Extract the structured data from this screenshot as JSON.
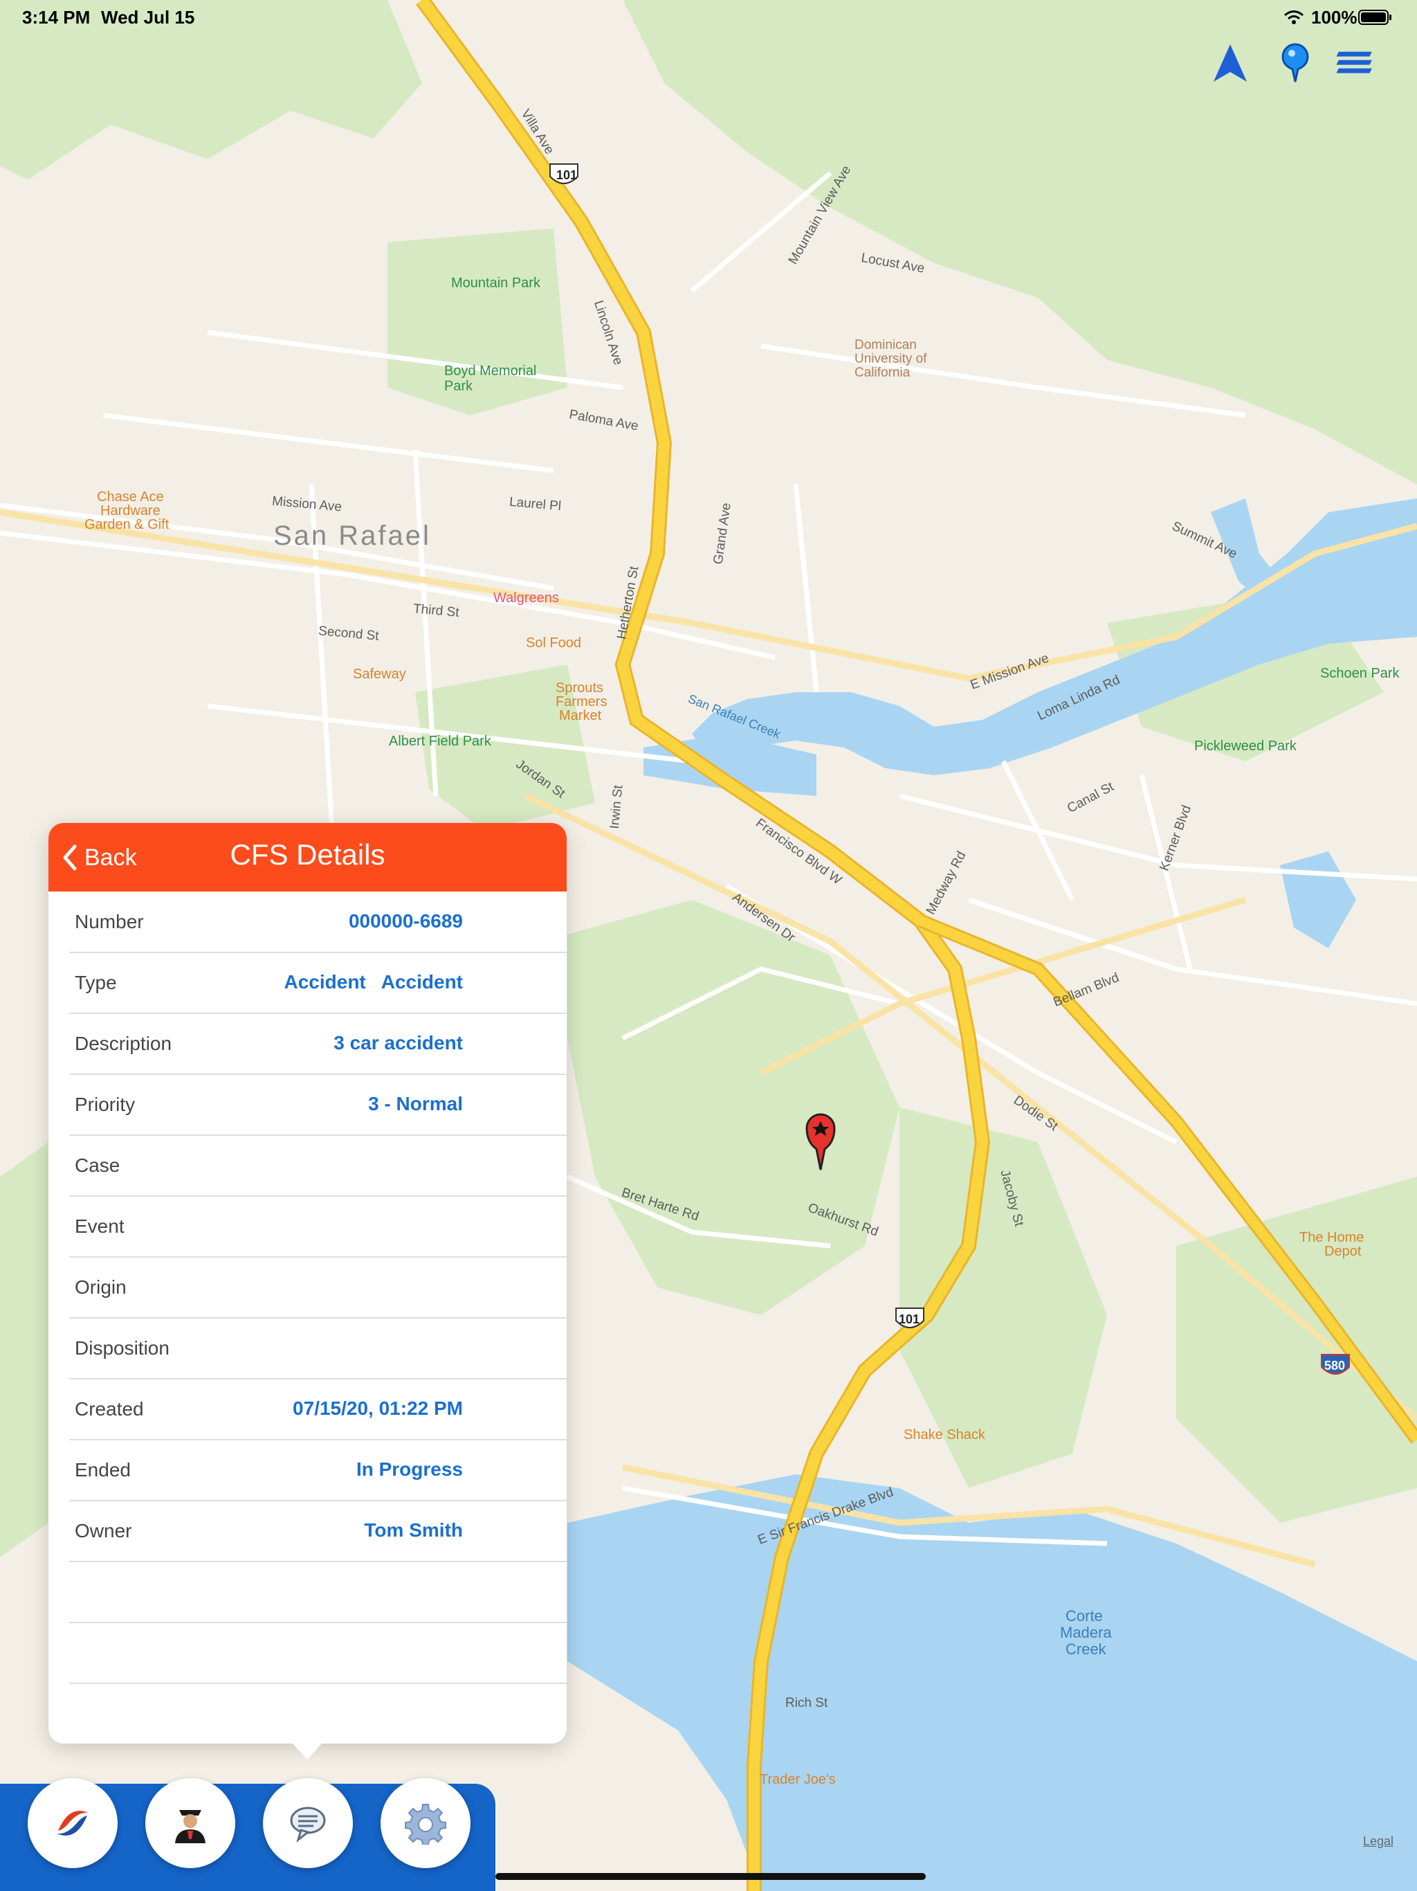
{
  "status_bar": {
    "time": "3:14 PM",
    "date": "Wed Jul 15",
    "battery": "100%"
  },
  "map": {
    "icons": [
      "navigation-arrow-icon",
      "map-pin-icon",
      "layers-icon"
    ],
    "labels": {
      "city": "San Rafael",
      "mountain_park": "Mountain Park",
      "boyd_park": "Boyd Memorial",
      "boyd_park2": "Park",
      "dominican1": "Dominican",
      "dominican2": "University of",
      "dominican3": "California",
      "chase1": "Chase Ace",
      "chase2": "Hardware",
      "chase3": "Garden & Gift",
      "walgreens": "Walgreens",
      "solfood": "Sol Food",
      "safeway": "Safeway",
      "sprouts1": "Sprouts",
      "sprouts2": "Farmers",
      "sprouts3": "Market",
      "albert": "Albert Field Park",
      "schoen": "Schoen Park",
      "pickleweed": "Pickleweed Park",
      "homedepot1": "The Home",
      "homedepot2": "Depot",
      "shakeshack": "Shake Shack",
      "traderjoes": "Trader Joe's",
      "corte1": "Corte",
      "corte2": "Madera",
      "corte3": "Creek",
      "villa": "Villa Ave",
      "lincoln": "Lincoln Ave",
      "mission": "Mission Ave",
      "third": "Third St",
      "second": "Second St",
      "francisco": "Francisco Blvd W",
      "andersen": "Andersen Dr",
      "bellam": "Bellam Blvd",
      "canal": "Canal St",
      "sirfrancis": "E Sir Francis Drake Blvd",
      "bretharte": "Bret Harte Rd",
      "oakhurst": "Oakhurst Rd",
      "hetherton": "Hetherton St",
      "irwin": "Irwin St",
      "grand": "Grand Ave",
      "locust": "Locust Ave",
      "mountainview": "Mountain View Ave",
      "paloma": "Paloma Ave",
      "laurel": "Laurel Pl",
      "jordan": "Jordan St",
      "sanrafaelcreek": "San Rafael Creek",
      "emission": "E Mission Ave",
      "lomalinda": "Loma Linda Rd",
      "summit": "Summit Ave",
      "kerner": "Kerner Blvd",
      "medway": "Medway Rd",
      "jacoby": "Jacoby St",
      "dodie": "Dodie St",
      "richst": "Rich St",
      "hwy101a": "101",
      "hwy101b": "101",
      "i580": "580",
      "legal": "Legal"
    }
  },
  "panel": {
    "back_label": "Back",
    "title": "CFS Details",
    "rows": [
      {
        "label": "Number",
        "value": "000000-6689"
      },
      {
        "label": "Type",
        "value": "Accident",
        "value2": "Accident"
      },
      {
        "label": "Description",
        "value": "3 car accident"
      },
      {
        "label": "Priority",
        "value": "3 - Normal"
      },
      {
        "label": "Case",
        "value": ""
      },
      {
        "label": "Event",
        "value": ""
      },
      {
        "label": "Origin",
        "value": ""
      },
      {
        "label": "Disposition",
        "value": ""
      },
      {
        "label": "Created",
        "value": "07/15/20, 01:22 PM"
      },
      {
        "label": "Ended",
        "value": "In Progress"
      },
      {
        "label": "Owner",
        "value": "Tom Smith"
      }
    ]
  },
  "tabbar": {
    "items": [
      "app-logo-icon",
      "officer-icon",
      "chat-icon",
      "settings-gear-icon"
    ]
  },
  "colors": {
    "header": "#fc4c1c",
    "value_text": "#1b6fd0",
    "tabbar": "#1564c8",
    "highway": "#f8cf3c",
    "water": "#a9d5f2",
    "park": "#cfe6b8"
  }
}
